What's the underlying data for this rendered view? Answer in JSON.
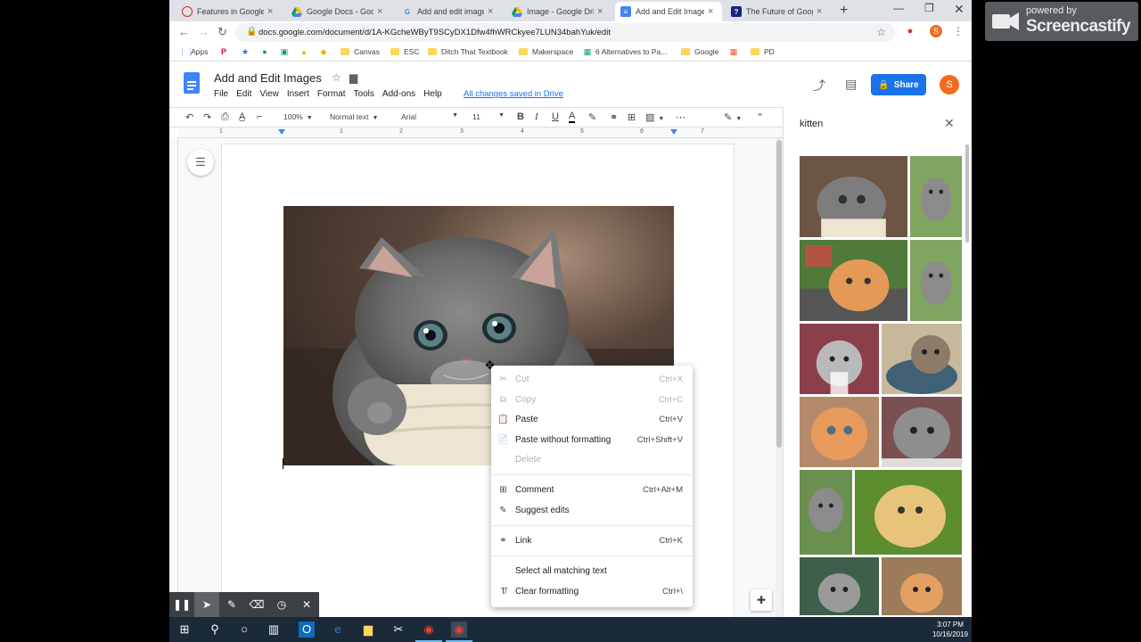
{
  "browser": {
    "tabs": [
      {
        "title": "Features in Google D",
        "active": false,
        "favicon": "circle-icon"
      },
      {
        "title": "Google Docs - Goog",
        "active": false,
        "favicon": "drive-icon"
      },
      {
        "title": "Add and edit image",
        "active": false,
        "favicon": "google-icon"
      },
      {
        "title": "Image - Google Driv",
        "active": false,
        "favicon": "drive-icon"
      },
      {
        "title": "Add and Edit Image",
        "active": true,
        "favicon": "docs-icon"
      },
      {
        "title": "The Future of Goog",
        "active": false,
        "favicon": "help-icon"
      }
    ],
    "url": "docs.google.com/document/d/1A-KGcheWByT9SCyDX1Dfw4fhWRCkyee7LUN34bahYuk/edit",
    "profile_initial": "S",
    "bookmarks": [
      "Apps",
      "Canvas",
      "ESC",
      "Ditch That Textbook",
      "Makerspace",
      "6 Alternatives to Pa...",
      "Google",
      "PD"
    ]
  },
  "doc": {
    "title": "Add and Edit Images",
    "menu": [
      "File",
      "Edit",
      "View",
      "Insert",
      "Format",
      "Tools",
      "Add-ons",
      "Help"
    ],
    "save_status": "All changes saved in Drive",
    "share_label": "Share",
    "user_initial": "S"
  },
  "toolbar": {
    "zoom": "100%",
    "style": "Normal text",
    "font": "Arial",
    "size": "11"
  },
  "ruler": {
    "marks": [
      "1",
      "1",
      "2",
      "3",
      "4",
      "5",
      "6",
      "7"
    ]
  },
  "image_search": {
    "query": "kitten",
    "result_count": 13
  },
  "context_menu": {
    "items": [
      {
        "label": "Cut",
        "shortcut": "Ctrl+X",
        "icon": "scissors-icon",
        "disabled": true
      },
      {
        "label": "Copy",
        "shortcut": "Ctrl+C",
        "icon": "copy-icon",
        "disabled": true
      },
      {
        "label": "Paste",
        "shortcut": "Ctrl+V",
        "icon": "clipboard-icon",
        "disabled": false
      },
      {
        "label": "Paste without formatting",
        "shortcut": "Ctrl+Shift+V",
        "icon": "paste-plain-icon",
        "disabled": false
      },
      {
        "label": "Delete",
        "shortcut": "",
        "icon": "",
        "disabled": true
      },
      {
        "label": "Comment",
        "shortcut": "Ctrl+Alt+M",
        "icon": "comment-icon",
        "disabled": false
      },
      {
        "label": "Suggest edits",
        "shortcut": "",
        "icon": "suggest-icon",
        "disabled": false
      },
      {
        "label": "Link",
        "shortcut": "Ctrl+K",
        "icon": "link-icon",
        "disabled": false
      },
      {
        "label": "Select all matching text",
        "shortcut": "",
        "icon": "",
        "disabled": false
      },
      {
        "label": "Clear formatting",
        "shortcut": "Ctrl+\\",
        "icon": "clear-format-icon",
        "disabled": false
      }
    ]
  },
  "watermark": {
    "line1": "powered by",
    "line2": "Screencastify"
  },
  "taskbar": {
    "time": "3:07 PM",
    "date": "10/16/2019"
  },
  "colors": {
    "accent": "#1a73e8",
    "docs_blue": "#4285f4",
    "taskbar": "#1b2a38"
  }
}
